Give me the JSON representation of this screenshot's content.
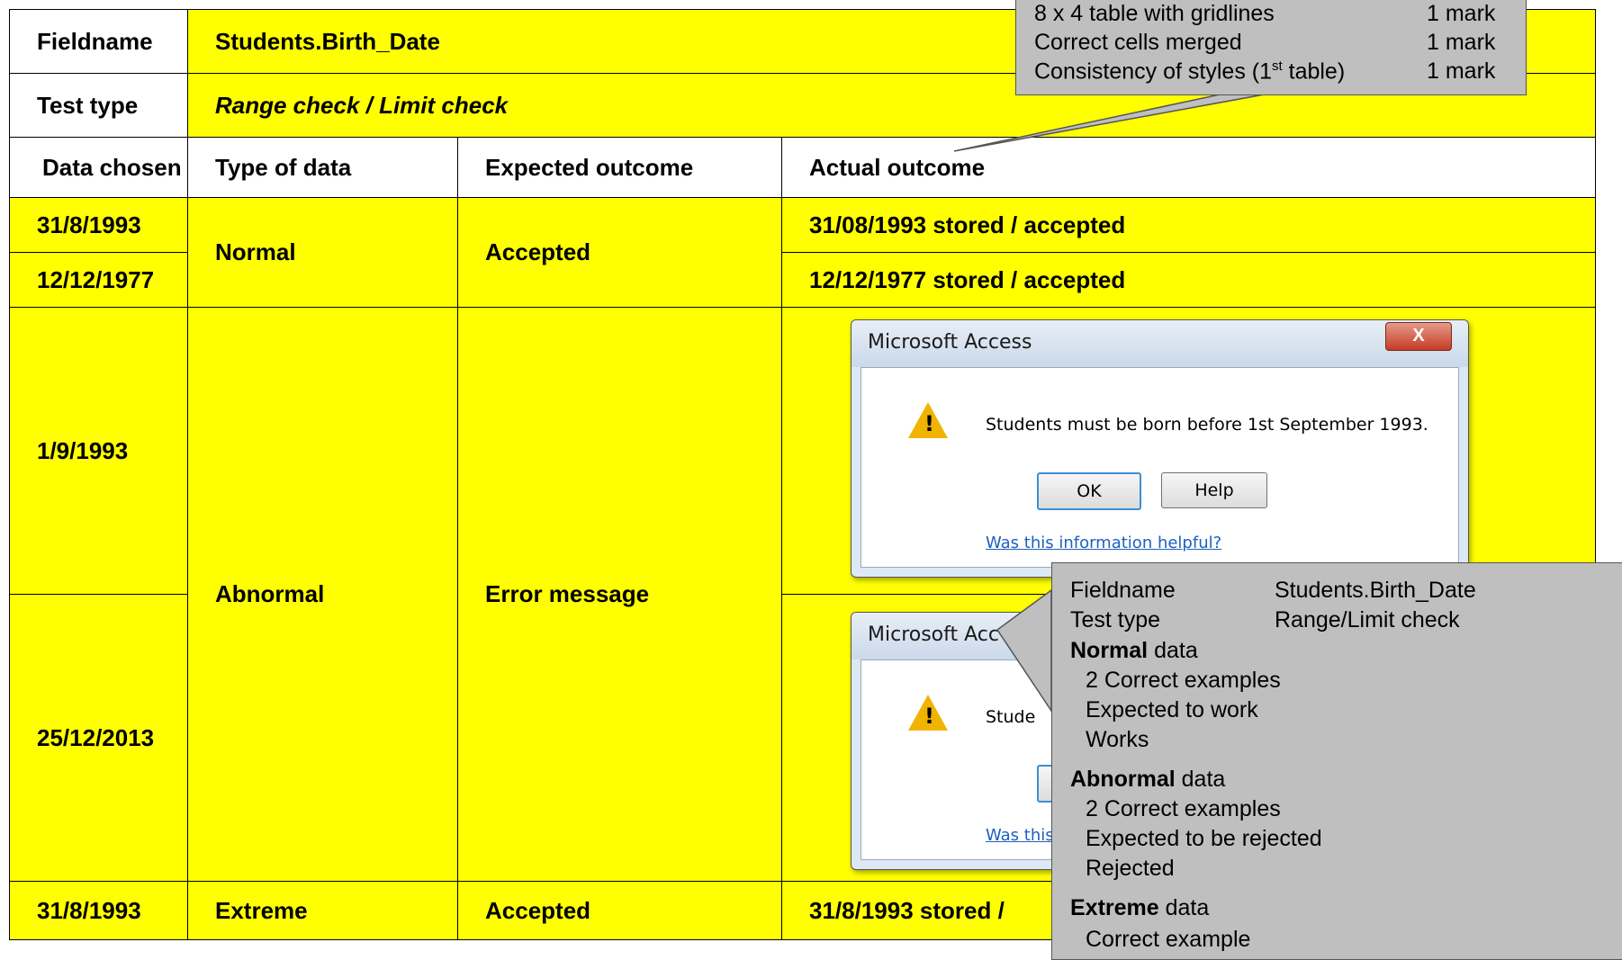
{
  "table": {
    "fieldname_label": "Fieldname",
    "fieldname_value": "Students.Birth_Date",
    "testtype_label": "Test type",
    "testtype_value": "Range check / Limit check",
    "headers": [
      "Data chosen",
      "Type of data",
      "Expected outcome",
      "Actual outcome"
    ],
    "rows": {
      "r1": {
        "data": "31/8/1993",
        "actual": "31/08/1993 stored / accepted"
      },
      "r2": {
        "data": "12/12/1977",
        "actual": "12/12/1977 stored / accepted"
      },
      "normal_type": "Normal",
      "normal_expected": "Accepted",
      "r3": {
        "data": "1/9/1993"
      },
      "r4": {
        "data": "25/12/2013"
      },
      "abnormal_type": "Abnormal",
      "abnormal_expected": "Error message",
      "r5": {
        "data": "31/8/1993",
        "type": "Extreme",
        "expected": "Accepted",
        "actual": "31/8/1993 stored /"
      }
    }
  },
  "dialog1": {
    "title": "Microsoft Access",
    "close": "X",
    "message": "Students must be born before 1st September 1993.",
    "ok": "OK",
    "help": "Help",
    "link": "Was this information helpful?"
  },
  "dialog2": {
    "title": "Microsoft Acc",
    "message": "Stude",
    "link": "Was this"
  },
  "callout_top": {
    "rows": [
      {
        "left": "8 x 4 table with gridlines",
        "right": "1 mark"
      },
      {
        "left": "Correct cells merged",
        "right": "1 mark"
      },
      {
        "left_a": "Consistency  of  styles (1",
        "sup": "st",
        "left_b": " table)",
        "right": "1 mark"
      }
    ]
  },
  "callout_bottom": {
    "fieldname_label": "Fieldname",
    "fieldname_value": "Students.Birth_Date",
    "testtype_label": "Test type",
    "testtype_value": "Range/Limit check",
    "normal_bold": "Normal",
    "normal_rest": " data",
    "normal_items": [
      "2 Correct examples",
      "Expected to work",
      "Works"
    ],
    "abnormal_bold": "Abnormal",
    "abnormal_rest": " data",
    "abnormal_items": [
      "2 Correct examples",
      "Expected to be rejected",
      "Rejected"
    ],
    "extreme_bold": "Extreme",
    "extreme_rest": " data",
    "extreme_partial": "Correct example"
  }
}
